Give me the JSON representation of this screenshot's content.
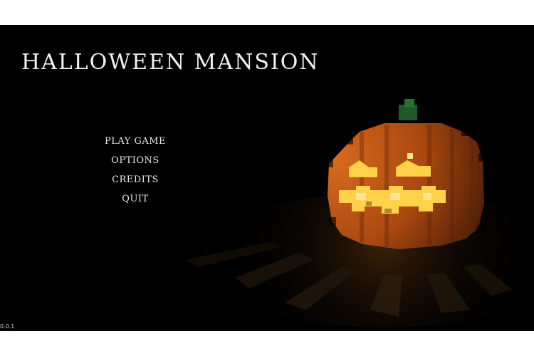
{
  "game": {
    "title": "HALLOWEEN MANSION",
    "version": "0.0.1"
  },
  "menu": {
    "items": [
      {
        "label": "PLAY GAME"
      },
      {
        "label": "OPTIONS"
      },
      {
        "label": "CREDITS"
      },
      {
        "label": "QUIT"
      }
    ]
  },
  "scene": {
    "subject": "pumpkin-icon",
    "colors": {
      "background": "#000000",
      "pumpkin_orange": "#c0561a",
      "pumpkin_dark": "#5a2208",
      "glow": "#ffd24a",
      "stem": "#1f5a2a"
    }
  }
}
